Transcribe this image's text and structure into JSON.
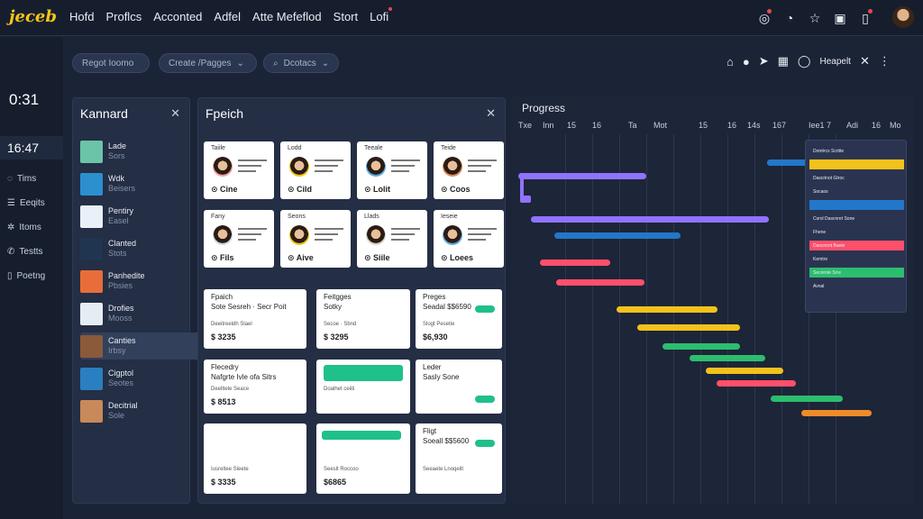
{
  "app": {
    "logo": "jeceb"
  },
  "nav": [
    "Hofd",
    "Proflcs",
    "Acconted",
    "Adfel",
    "Atte Mefeflod",
    "Stort",
    "Lofi"
  ],
  "header_icons": [
    "notification-icon",
    "clock-icon",
    "star-icon",
    "box-icon",
    "mobile-icon"
  ],
  "left": {
    "time1": "0:31",
    "time2": "16:47",
    "items": [
      {
        "icon": "chat-icon",
        "label": "Tims"
      },
      {
        "icon": "list-icon",
        "label": "Eeqits"
      },
      {
        "icon": "gear-icon",
        "label": "Itoms"
      },
      {
        "icon": "phone-icon",
        "label": "Testts"
      },
      {
        "icon": "document-icon",
        "label": "Poetng"
      }
    ]
  },
  "toolbar": {
    "pills": [
      "Regot Ioomo",
      "Create /Pagges",
      "Dcotacs"
    ],
    "right_label": "Heapelt"
  },
  "kanban": {
    "title": "Kannard",
    "rows": [
      {
        "t": "Lade",
        "s": "Sors"
      },
      {
        "t": "Wdk",
        "s": "Beisers"
      },
      {
        "t": "Pentiry",
        "s": "Easel"
      },
      {
        "t": "Clanted",
        "s": "Stots"
      },
      {
        "t": "Panhedite",
        "s": "Pbsies"
      },
      {
        "t": "Drofies",
        "s": "Mooss"
      },
      {
        "t": "Canties",
        "s": "Irbsy"
      },
      {
        "t": "Cigptol",
        "s": "Seotes"
      },
      {
        "t": "Decitrial",
        "s": "Sole"
      }
    ]
  },
  "fetch": {
    "title": "Fpeich",
    "profiles": [
      {
        "t": "Taiile",
        "n": "Cine"
      },
      {
        "t": "Lodd",
        "n": "Cild"
      },
      {
        "t": "Teeale",
        "n": "Lolit"
      },
      {
        "t": "Teide",
        "n": "Coos"
      },
      {
        "t": "Fany",
        "n": "Fils"
      },
      {
        "t": "Seons",
        "n": "Aive"
      },
      {
        "t": "Llads",
        "n": "Siile"
      },
      {
        "t": "Ieseie",
        "n": "Loees"
      }
    ],
    "cards": [
      {
        "a": "Fpaich",
        "b": "Sote Sesreh · Secr Poit",
        "c": "Deeitreeldh Slael",
        "p": "$ 3235"
      },
      {
        "a": "Feitgges",
        "b": "Sotky",
        "c": "Secoe · Sbnd",
        "p": "$ 3295"
      },
      {
        "a": "Preges",
        "b": "Seadal $$6590",
        "c": "Slogt Pesetie",
        "p": "$6,930"
      },
      {
        "a": "Flecedry",
        "b": "Nafgrte Ivle ofa Sitrs",
        "c": "Deelltele Seace",
        "p": "$ 8513"
      },
      {
        "a": "",
        "b": "",
        "c": "Doalhet ceiiti",
        "p": ""
      },
      {
        "a": "Leder",
        "b": "Sasly Sone",
        "c": "",
        "p": ""
      },
      {
        "a": "",
        "b": "",
        "c": "Iusreltee Sleete",
        "p": "$ 3335"
      },
      {
        "a": "",
        "b": "",
        "c": "Seeslt Roccoo",
        "p": "$6865"
      },
      {
        "a": "Fligt",
        "b": "Soeall $$5600",
        "c": "Seeaete Lnoqeilt",
        "p": ""
      }
    ]
  },
  "progress": {
    "title": "Progress",
    "ticks": [
      "Txe",
      "Inn",
      "15",
      "16",
      "Ta",
      "Mot",
      "15",
      "16",
      "14s",
      "167",
      "Iee1",
      "7",
      "Adi",
      "16",
      "Mo"
    ],
    "legend": [
      "Domtrcs Scrtite",
      "",
      "Dascrinot Gtroc",
      "Socaos",
      "",
      "Csrol Dascnret Sone",
      "Fhene",
      "Dascnont Baeie",
      "Kemtre",
      "Secorote Srre",
      "Avnal"
    ],
    "colors": [
      "#f2c21b",
      "#8f73ff",
      "#4a6ad8",
      "#2277c8",
      "#ff4f6a",
      "#2dbd6e",
      "#f08b2a"
    ]
  }
}
